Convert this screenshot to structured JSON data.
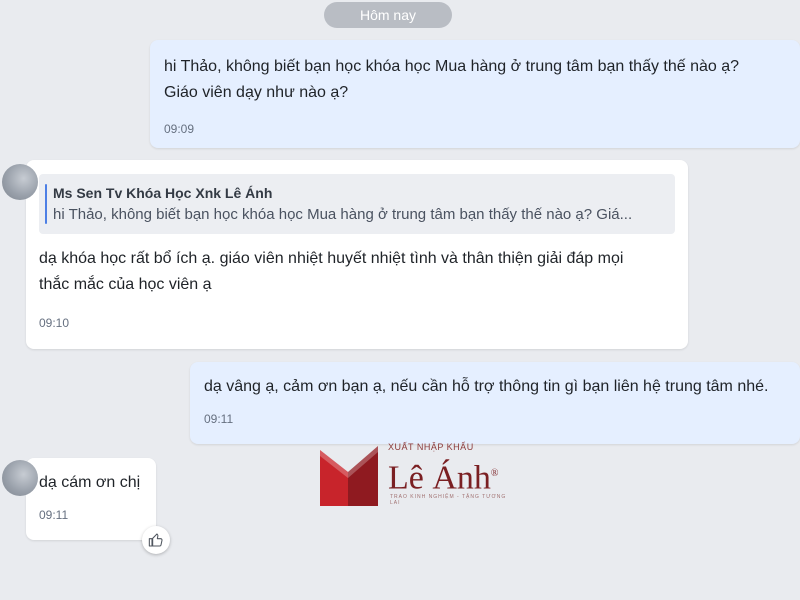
{
  "date_separator": "Hôm nay",
  "messages": [
    {
      "direction": "out",
      "text": "hi Thảo, không biết bạn học khóa học Mua hàng ở trung tâm bạn thấy thế nào ạ?\nGiáo viên dạy như nào ạ?",
      "time": "09:09"
    },
    {
      "direction": "in",
      "quote": {
        "author": "Ms Sen Tv Khóa Học Xnk Lê Ánh",
        "text": "hi Thảo, không biết bạn học khóa học Mua hàng ở trung tâm bạn thấy thế nào ạ? Giá..."
      },
      "text": "dạ khóa học rất bổ ích ạ. giáo viên nhiệt huyết nhiệt tình và thân thiện giải đáp mọi\nthắc mắc của học viên ạ",
      "time": "09:10"
    },
    {
      "direction": "out",
      "text": "dạ vâng ạ, cảm ơn bạn ạ, nếu cần hỗ trợ thông tin gì bạn liên hệ trung tâm nhé.",
      "time": "09:11"
    },
    {
      "direction": "in",
      "text": "dạ cám ơn chị",
      "time": "09:11"
    }
  ],
  "watermark": {
    "top": "XUẤT NHẬP KHẨU",
    "name": "Lê Ánh",
    "registered": "®",
    "tagline": "TRAO KINH NGHIỆM - TẶNG TƯƠNG LAI"
  },
  "colors": {
    "background": "#e9ebef",
    "outgoing_bubble": "#e5efff",
    "incoming_bubble": "#ffffff",
    "quote_bar": "#4d7fe5",
    "logo_red": "#c8242b"
  },
  "icons": {
    "like": "thumbs-up-icon",
    "avatar": "contact-avatar"
  }
}
